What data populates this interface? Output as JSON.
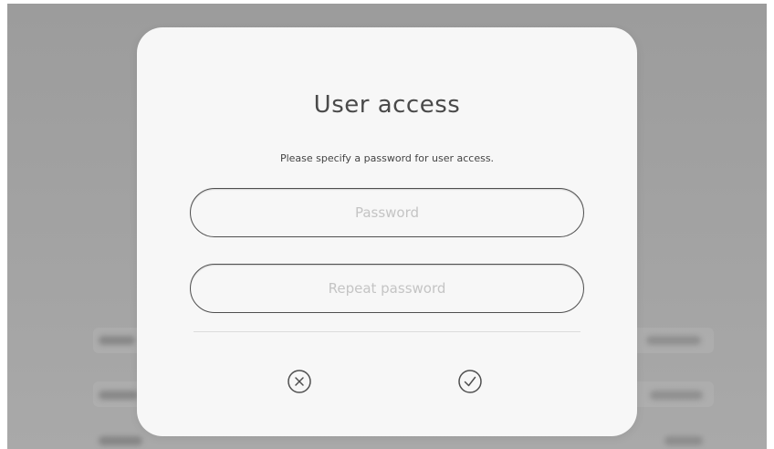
{
  "dialog": {
    "title": "User access",
    "message": "Please specify a password for user access.",
    "password_placeholder": "Password",
    "repeat_password_placeholder": "Repeat password",
    "cancel_icon": "close-circle-icon",
    "confirm_icon": "check-circle-icon"
  },
  "colors": {
    "overlay": "#a0a0a0",
    "dialog_background": "#f7f7f7",
    "field_border": "#4f4f4f",
    "title_text": "#4a4a4a",
    "placeholder_text": "#c4c4c4"
  }
}
